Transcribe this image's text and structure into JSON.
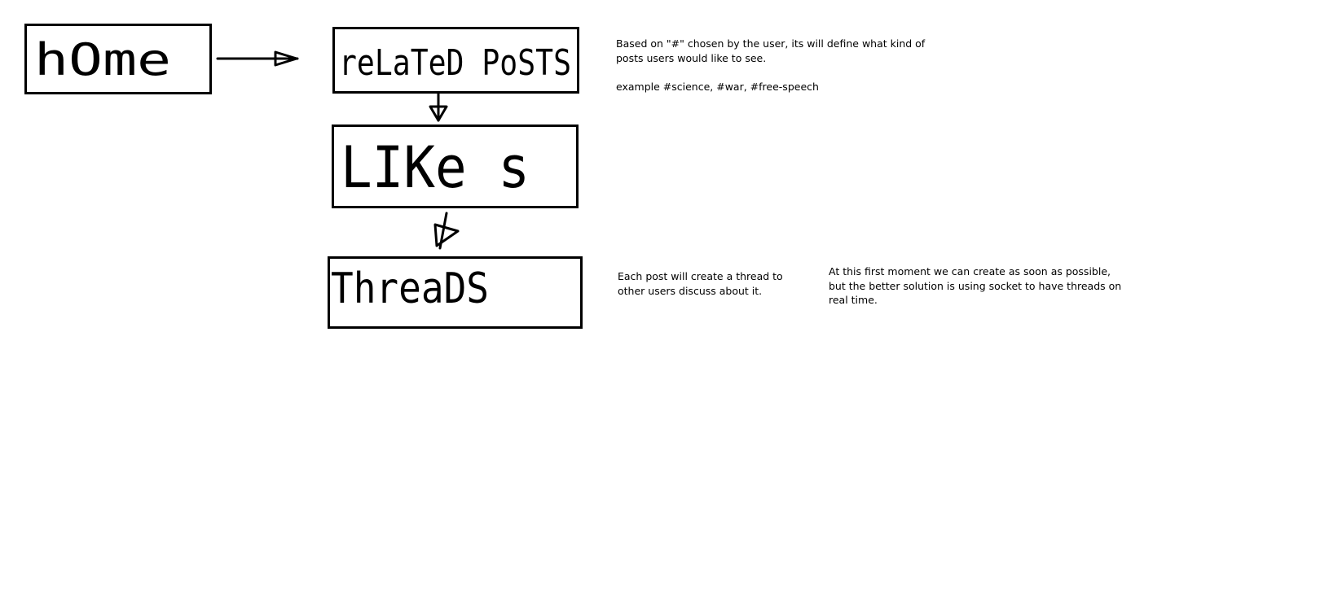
{
  "diagram": {
    "nodes": [
      {
        "id": "home",
        "label": "hOme"
      },
      {
        "id": "related-posts",
        "label": "reLaTeD PoSTS"
      },
      {
        "id": "likes",
        "label": "LIKe s"
      },
      {
        "id": "threads",
        "label": "ThreaDS"
      }
    ],
    "edges": [
      {
        "from": "home",
        "to": "related-posts"
      },
      {
        "from": "related-posts",
        "to": "likes"
      },
      {
        "from": "likes",
        "to": "threads"
      }
    ]
  },
  "notes": {
    "related_posts": {
      "line1": "Based on \"#\" chosen by the user, its will define what kind of posts users would like to see.",
      "line2": "example #science, #war, #free-speech"
    },
    "threads": {
      "text": "Each post will create a thread to other users discuss about it."
    },
    "realtime": {
      "text": "At this first moment we can create as soon as possible, but the better solution is using socket to have threads on real time."
    }
  }
}
